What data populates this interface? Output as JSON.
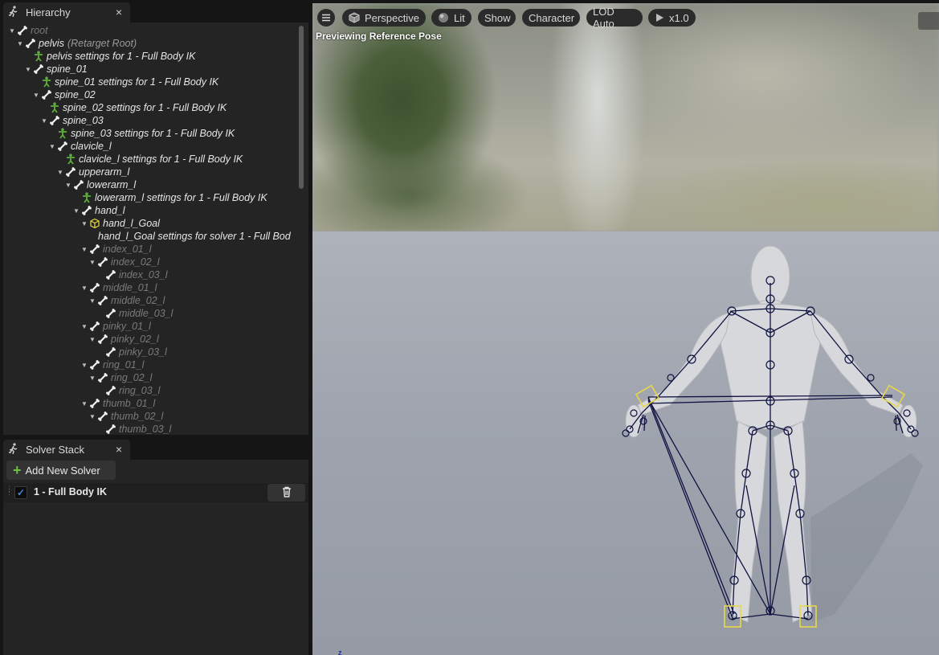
{
  "hierarchy": {
    "title": "Hierarchy",
    "close": "×",
    "rows": [
      {
        "label": "root",
        "sub": "",
        "depth": 0,
        "icon": "bone",
        "arrow": true,
        "dim": true
      },
      {
        "label": "pelvis",
        "sub": "(Retarget Root)",
        "depth": 1,
        "icon": "bone",
        "arrow": true,
        "dim": false
      },
      {
        "label": "pelvis settings for 1 - Full Body IK",
        "sub": "",
        "depth": 2,
        "icon": "settings",
        "arrow": false,
        "dim": false
      },
      {
        "label": "spine_01",
        "sub": "",
        "depth": 2,
        "icon": "bone",
        "arrow": true,
        "dim": false
      },
      {
        "label": "spine_01 settings for 1 - Full Body IK",
        "sub": "",
        "depth": 3,
        "icon": "settings",
        "arrow": false,
        "dim": false
      },
      {
        "label": "spine_02",
        "sub": "",
        "depth": 3,
        "icon": "bone",
        "arrow": true,
        "dim": false
      },
      {
        "label": "spine_02 settings for 1 - Full Body IK",
        "sub": "",
        "depth": 4,
        "icon": "settings",
        "arrow": false,
        "dim": false
      },
      {
        "label": "spine_03",
        "sub": "",
        "depth": 4,
        "icon": "bone",
        "arrow": true,
        "dim": false
      },
      {
        "label": "spine_03 settings for 1 - Full Body IK",
        "sub": "",
        "depth": 5,
        "icon": "settings",
        "arrow": false,
        "dim": false
      },
      {
        "label": "clavicle_l",
        "sub": "",
        "depth": 5,
        "icon": "bone",
        "arrow": true,
        "dim": false
      },
      {
        "label": "clavicle_l settings for 1 - Full Body IK",
        "sub": "",
        "depth": 6,
        "icon": "settings",
        "arrow": false,
        "dim": false
      },
      {
        "label": "upperarm_l",
        "sub": "",
        "depth": 6,
        "icon": "bone",
        "arrow": true,
        "dim": false
      },
      {
        "label": "lowerarm_l",
        "sub": "",
        "depth": 7,
        "icon": "bone",
        "arrow": true,
        "dim": false
      },
      {
        "label": "lowerarm_l settings for 1 - Full Body IK",
        "sub": "",
        "depth": 8,
        "icon": "settings",
        "arrow": false,
        "dim": false
      },
      {
        "label": "hand_l",
        "sub": "",
        "depth": 8,
        "icon": "bone",
        "arrow": true,
        "dim": false
      },
      {
        "label": "hand_l_Goal",
        "sub": "",
        "depth": 9,
        "icon": "goal",
        "arrow": true,
        "dim": false
      },
      {
        "label": "hand_l_Goal settings for solver 1 - Full Bod",
        "sub": "",
        "depth": 10,
        "icon": "none",
        "arrow": false,
        "dim": false
      },
      {
        "label": "index_01_l",
        "sub": "",
        "depth": 9,
        "icon": "bone",
        "arrow": true,
        "dim": true
      },
      {
        "label": "index_02_l",
        "sub": "",
        "depth": 10,
        "icon": "bone",
        "arrow": true,
        "dim": true
      },
      {
        "label": "index_03_l",
        "sub": "",
        "depth": 11,
        "icon": "bone",
        "arrow": false,
        "dim": true
      },
      {
        "label": "middle_01_l",
        "sub": "",
        "depth": 9,
        "icon": "bone",
        "arrow": true,
        "dim": true
      },
      {
        "label": "middle_02_l",
        "sub": "",
        "depth": 10,
        "icon": "bone",
        "arrow": true,
        "dim": true
      },
      {
        "label": "middle_03_l",
        "sub": "",
        "depth": 11,
        "icon": "bone",
        "arrow": false,
        "dim": true
      },
      {
        "label": "pinky_01_l",
        "sub": "",
        "depth": 9,
        "icon": "bone",
        "arrow": true,
        "dim": true
      },
      {
        "label": "pinky_02_l",
        "sub": "",
        "depth": 10,
        "icon": "bone",
        "arrow": true,
        "dim": true
      },
      {
        "label": "pinky_03_l",
        "sub": "",
        "depth": 11,
        "icon": "bone",
        "arrow": false,
        "dim": true
      },
      {
        "label": "ring_01_l",
        "sub": "",
        "depth": 9,
        "icon": "bone",
        "arrow": true,
        "dim": true
      },
      {
        "label": "ring_02_l",
        "sub": "",
        "depth": 10,
        "icon": "bone",
        "arrow": true,
        "dim": true
      },
      {
        "label": "ring_03_l",
        "sub": "",
        "depth": 11,
        "icon": "bone",
        "arrow": false,
        "dim": true
      },
      {
        "label": "thumb_01_l",
        "sub": "",
        "depth": 9,
        "icon": "bone",
        "arrow": true,
        "dim": true
      },
      {
        "label": "thumb_02_l",
        "sub": "",
        "depth": 10,
        "icon": "bone",
        "arrow": true,
        "dim": true
      },
      {
        "label": "thumb_03_l",
        "sub": "",
        "depth": 11,
        "icon": "bone",
        "arrow": false,
        "dim": true
      }
    ]
  },
  "solver_stack": {
    "title": "Solver Stack",
    "close": "×",
    "add_label": "Add New Solver",
    "solvers": [
      {
        "name": "1 - Full Body IK",
        "enabled": true
      }
    ]
  },
  "viewport": {
    "menu_icon": "hamburger-icon",
    "perspective_label": "Perspective",
    "lit_label": "Lit",
    "show_label": "Show",
    "character_label": "Character",
    "lod_label": "LOD Auto",
    "speed_label": "x1.0",
    "preview_label": "Previewing Reference Pose",
    "axis_label": "z"
  },
  "colors": {
    "panel": "#242424",
    "background": "#151515",
    "accent_green": "#6fc043",
    "goal_yellow": "#e6d84a",
    "skeleton": "#0f1240",
    "checkbox": "#3f86e6"
  }
}
